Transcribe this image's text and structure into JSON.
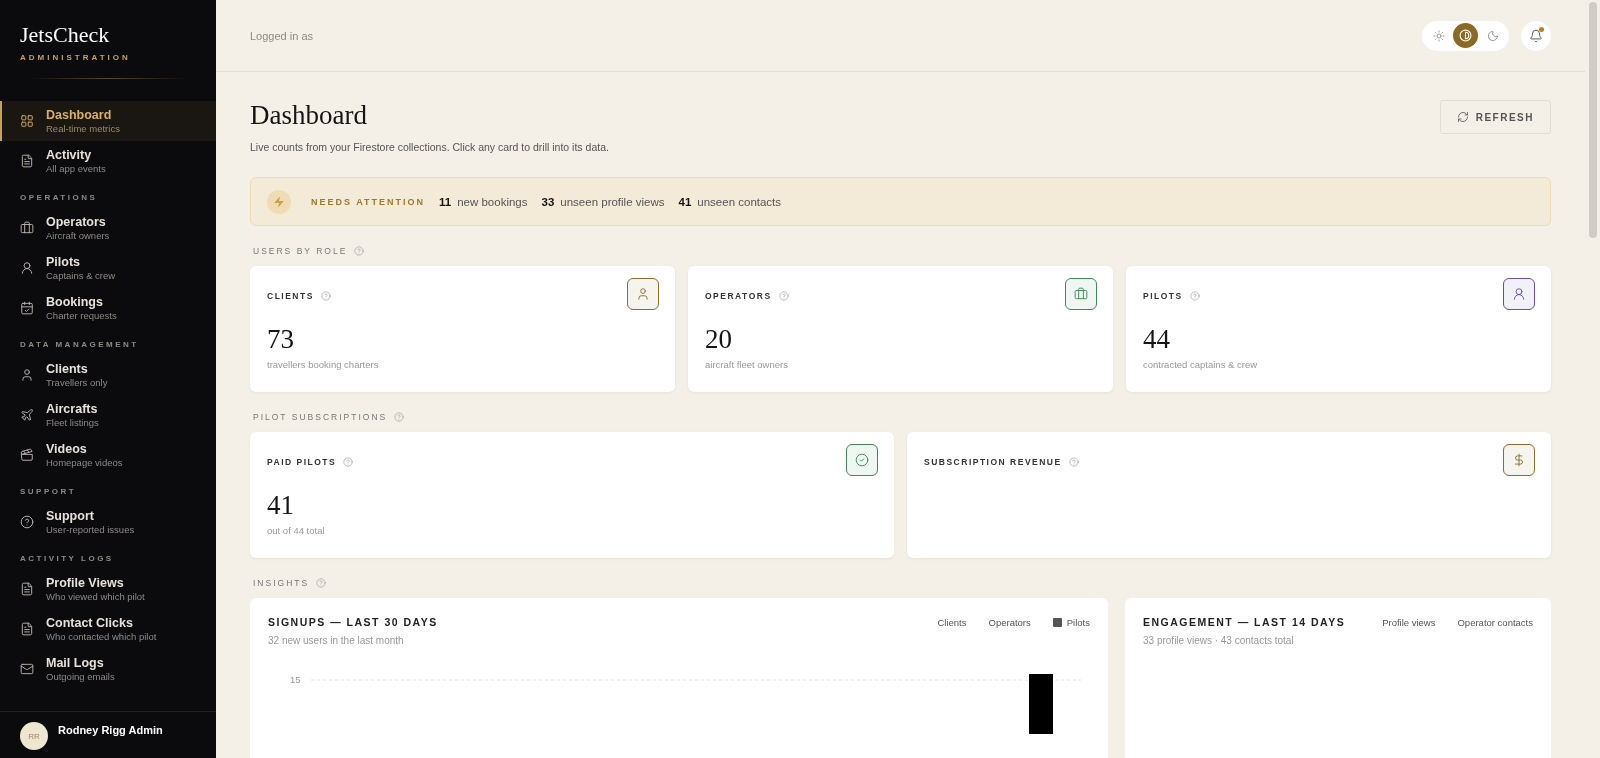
{
  "brand": {
    "name": "JetsCheck",
    "tagline": "ADMINISTRATION"
  },
  "nav": {
    "items": [
      {
        "kind": "grid",
        "label": "Dashboard",
        "sub": "Real-time metrics",
        "selected": true
      },
      {
        "kind": "document",
        "label": "Activity",
        "sub": "All app events",
        "selected": false
      }
    ],
    "sections": [
      {
        "title": "OPERATIONS",
        "items": [
          {
            "kind": "briefcase",
            "label": "Operators",
            "sub": "Aircraft owners",
            "selected": false
          },
          {
            "kind": "pilot",
            "label": "Pilots",
            "sub": "Captains & crew",
            "selected": false
          },
          {
            "kind": "calendar",
            "label": "Bookings",
            "sub": "Charter requests",
            "selected": false
          }
        ]
      },
      {
        "title": "DATA MANAGEMENT",
        "items": [
          {
            "kind": "user",
            "label": "Clients",
            "sub": "Travellers only",
            "selected": false
          },
          {
            "kind": "plane",
            "label": "Aircrafts",
            "sub": "Fleet listings",
            "selected": false
          },
          {
            "kind": "video",
            "label": "Videos",
            "sub": "Homepage videos",
            "selected": false
          }
        ]
      },
      {
        "title": "SUPPORT",
        "items": [
          {
            "kind": "help",
            "label": "Support",
            "sub": "User-reported issues",
            "selected": false
          }
        ]
      },
      {
        "title": "ACTIVITY LOGS",
        "items": [
          {
            "kind": "document",
            "label": "Profile Views",
            "sub": "Who viewed which pilot",
            "selected": false
          },
          {
            "kind": "document",
            "label": "Contact Clicks",
            "sub": "Who contacted which pilot",
            "selected": false
          },
          {
            "kind": "mail",
            "label": "Mail Logs",
            "sub": "Outgoing emails",
            "selected": false
          }
        ]
      }
    ]
  },
  "user": {
    "initials": "RR",
    "name": "Rodney Rigg Admin"
  },
  "header": {
    "logged_in": "Logged in as",
    "theme_options": [
      {
        "kind": "light",
        "selected": false
      },
      {
        "kind": "auto",
        "selected": true
      },
      {
        "kind": "dark",
        "selected": false
      }
    ],
    "notifications_unread": true
  },
  "page": {
    "title": "Dashboard",
    "subtitle": "Live counts from your Firestore collections. Click any card to drill into its data.",
    "refresh": "REFRESH"
  },
  "attention": {
    "label": "NEEDS ATTENTION",
    "items": [
      {
        "count": "11",
        "text": "new bookings"
      },
      {
        "count": "33",
        "text": "unseen profile views"
      },
      {
        "count": "41",
        "text": "unseen contacts"
      }
    ]
  },
  "sections": [
    {
      "title": "USERS BY ROLE",
      "cards": [
        {
          "title": "CLIENTS",
          "kind": "user",
          "color": "#8a6d2b",
          "value": "73",
          "caption": "travellers booking charters"
        },
        {
          "title": "OPERATORS",
          "kind": "briefcase",
          "color": "#3f8a5a",
          "value": "20",
          "caption": "aircraft fleet owners"
        },
        {
          "title": "PILOTS",
          "kind": "pilot",
          "color": "#6a4fa3",
          "value": "44",
          "caption": "contracted captains & crew"
        }
      ]
    },
    {
      "title": "PILOT SUBSCRIPTIONS",
      "cards": [
        {
          "title": "PAID PILOTS",
          "kind": "check",
          "color": "#3f8a5a",
          "value": "41",
          "caption": "out of 44 total"
        },
        {
          "title": "SUBSCRIPTION REVENUE",
          "kind": "dollar",
          "color": "#8a6d2b"
        }
      ]
    }
  ],
  "insights": {
    "title": "INSIGHTS",
    "charts": [
      {
        "title": "SIGNUPS — LAST 30 DAYS",
        "subtitle": "32 new users in the last month",
        "legend": [
          {
            "label": "Clients",
            "visible": false
          },
          {
            "label": "Operators",
            "visible": false
          },
          {
            "label": "Pilots",
            "visible": true
          }
        ],
        "ytick": "15"
      },
      {
        "title": "ENGAGEMENT — LAST 14 DAYS",
        "subtitle": "33 profile views · 43 contacts total",
        "legend": [
          {
            "label": "Profile views",
            "visible": false
          },
          {
            "label": "Operator contacts",
            "visible": false
          }
        ]
      }
    ]
  }
}
